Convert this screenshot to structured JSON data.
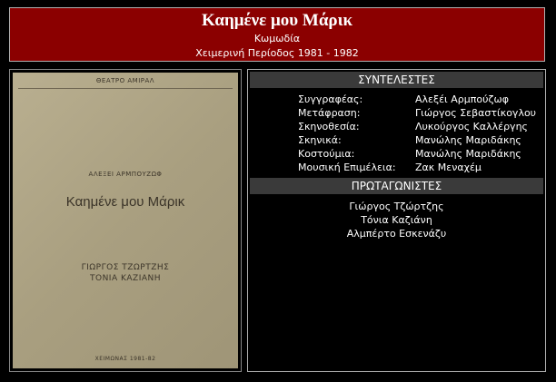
{
  "header": {
    "title": "Καημένε μου Μάρικ",
    "genre": "Κωμωδία",
    "season": "Χειμερινή Περίοδος 1981 - 1982"
  },
  "poster": {
    "theatre": "ΘΕΑΤΡΟ ΑΜΙΡΑΛ",
    "author": "ΑΛΕΞΕΙ ΑΡΜΠΟΥΖΩΦ",
    "title": "Καημένε μου Μάρικ",
    "actor1": "ΓΙΩΡΓΟΣ ΤΖΩΡΤΖΗΣ",
    "actor2": "ΤΟΝΙΑ ΚΑΖΙΑΝΗ",
    "season": "ΧΕΙΜΩΝΑΣ 1981-82"
  },
  "credits": {
    "heading": "ΣΥΝΤΕΛΕΣΤΕΣ",
    "rows": [
      {
        "role": "Συγγραφέας:",
        "name": "Αλεξέι Αρμπούζωφ"
      },
      {
        "role": "Μετάφραση:",
        "name": "Γιώργος Σεβαστίκογλου"
      },
      {
        "role": "Σκηνοθεσία:",
        "name": "Λυκούργος Καλλέργης"
      },
      {
        "role": "Σκηνικά:",
        "name": "Μανώλης Μαριδάκης"
      },
      {
        "role": "Κοστούμια:",
        "name": "Μανώλης Μαριδάκης"
      },
      {
        "role": "Μουσική Επιμέλεια:",
        "name": "Ζακ Μεναχέμ"
      }
    ]
  },
  "cast": {
    "heading": "ΠΡΩΤΑΓΩΝΙΣΤΕΣ",
    "names": [
      "Γιώργος Τζώρτζης",
      "Τόνια Καζιάνη",
      "Αλμπέρτο Εσκενάζυ"
    ]
  },
  "colors": {
    "header_bg": "#8b0000",
    "bar_bg": "#3a3a3a",
    "poster_bg": "#b0a685"
  }
}
